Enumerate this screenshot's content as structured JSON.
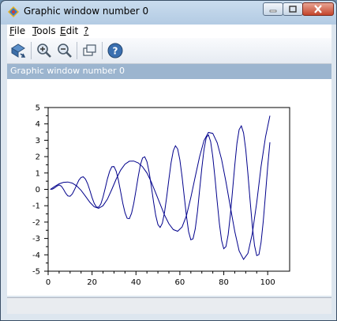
{
  "window": {
    "title": "Graphic window number 0",
    "controls": {
      "minimize": "minimize",
      "maximize": "maximize",
      "close": "close"
    }
  },
  "menu": {
    "items": [
      {
        "label": "File",
        "mnemonic": "F"
      },
      {
        "label": "Tools",
        "mnemonic": "T"
      },
      {
        "label": "Edit",
        "mnemonic": "E"
      },
      {
        "label": "?",
        "mnemonic": "?"
      }
    ]
  },
  "toolbar": {
    "icons": [
      "rotate-2d-3d-icon",
      "zoom-icon",
      "unzoom-icon",
      "select-figure-icon",
      "help-icon"
    ]
  },
  "header_label": "Graphic window number 0",
  "chart_data": {
    "type": "line",
    "title": "",
    "xlabel": "",
    "ylabel": "",
    "xlim": [
      0,
      110
    ],
    "ylim": [
      -5,
      5
    ],
    "x_ticks": [
      "0",
      "20",
      "40",
      "60",
      "80",
      "100"
    ],
    "y_ticks": [
      "-5",
      "-4",
      "-3",
      "-2",
      "-1",
      "0",
      "1",
      "2",
      "3",
      "4",
      "5"
    ],
    "grid": false,
    "color": "#00008b",
    "series": [
      {
        "x": [
          1,
          2,
          3,
          4,
          5,
          6,
          7,
          8,
          9,
          10,
          11,
          12,
          13,
          14,
          15,
          16,
          17,
          18,
          19,
          20,
          21,
          22,
          23,
          24,
          25,
          26,
          27,
          28,
          29,
          30,
          31,
          32,
          33,
          34,
          35,
          36,
          37,
          38,
          39,
          40,
          41,
          42,
          43,
          44,
          45,
          46,
          47,
          48,
          49,
          50,
          51,
          52,
          53,
          54,
          55,
          56,
          57,
          58,
          59,
          60,
          61,
          62,
          63,
          64,
          65,
          66,
          67,
          68,
          69,
          70,
          71,
          72,
          73,
          74,
          75,
          76,
          77,
          78,
          79,
          80,
          81,
          82,
          83,
          84,
          85,
          86,
          87,
          88,
          89,
          90,
          91,
          92,
          93,
          94,
          95,
          96,
          97,
          98,
          99,
          100,
          101
        ],
        "y": [
          0.0,
          0.02,
          0.09,
          0.2,
          0.27,
          0.2,
          0.0,
          -0.24,
          -0.4,
          -0.42,
          -0.28,
          -0.02,
          0.28,
          0.56,
          0.73,
          0.77,
          0.63,
          0.34,
          -0.07,
          -0.5,
          -0.86,
          -1.08,
          -1.09,
          -0.89,
          -0.48,
          0.07,
          0.64,
          1.1,
          1.38,
          1.39,
          1.11,
          0.57,
          -0.13,
          -0.85,
          -1.43,
          -1.77,
          -1.79,
          -1.46,
          -0.85,
          -0.06,
          0.78,
          1.48,
          1.92,
          1.99,
          1.69,
          1.05,
          0.19,
          -0.75,
          -1.59,
          -2.15,
          -2.33,
          -2.07,
          -1.42,
          -0.47,
          0.62,
          1.64,
          2.36,
          2.66,
          2.47,
          1.8,
          0.77,
          -0.46,
          -1.65,
          -2.59,
          -3.08,
          -3.02,
          -2.41,
          -1.36,
          -0.05,
          1.29,
          2.43,
          3.16,
          3.33,
          2.92,
          2.0,
          0.7,
          -0.75,
          -2.1,
          -3.13,
          -3.63,
          -3.5,
          -2.77,
          -1.55,
          -0.05,
          1.49,
          2.8,
          3.65,
          3.88,
          3.45,
          2.42,
          0.97,
          -0.68,
          -2.23,
          -3.43,
          -4.05,
          -3.98,
          -3.23,
          -1.93,
          -0.3,
          1.4,
          2.88
        ]
      },
      {
        "x": [
          1,
          3,
          5,
          7,
          9,
          11,
          13,
          15,
          17,
          19,
          21,
          23,
          25,
          27,
          29,
          31,
          33,
          35,
          37,
          39,
          41,
          43,
          45,
          47,
          49,
          51,
          53,
          55,
          57,
          59,
          61,
          63,
          65,
          67,
          69,
          71,
          73,
          75,
          77,
          79,
          81,
          83,
          85,
          87,
          89,
          91,
          93,
          95,
          97,
          99,
          101
        ],
        "y": [
          0.0,
          0.18,
          0.34,
          0.43,
          0.45,
          0.38,
          0.21,
          -0.06,
          -0.42,
          -0.79,
          -1.07,
          -1.16,
          -1.0,
          -0.6,
          0.0,
          0.63,
          1.17,
          1.54,
          1.72,
          1.73,
          1.62,
          1.38,
          1.0,
          0.45,
          -0.22,
          -0.9,
          -1.56,
          -2.1,
          -2.46,
          -2.56,
          -2.3,
          -1.6,
          -0.5,
          0.78,
          2.0,
          2.98,
          3.48,
          3.42,
          2.85,
          1.82,
          0.46,
          -1.08,
          -2.58,
          -3.76,
          -4.28,
          -3.92,
          -2.7,
          -0.8,
          1.4,
          3.2,
          4.5
        ]
      }
    ]
  }
}
